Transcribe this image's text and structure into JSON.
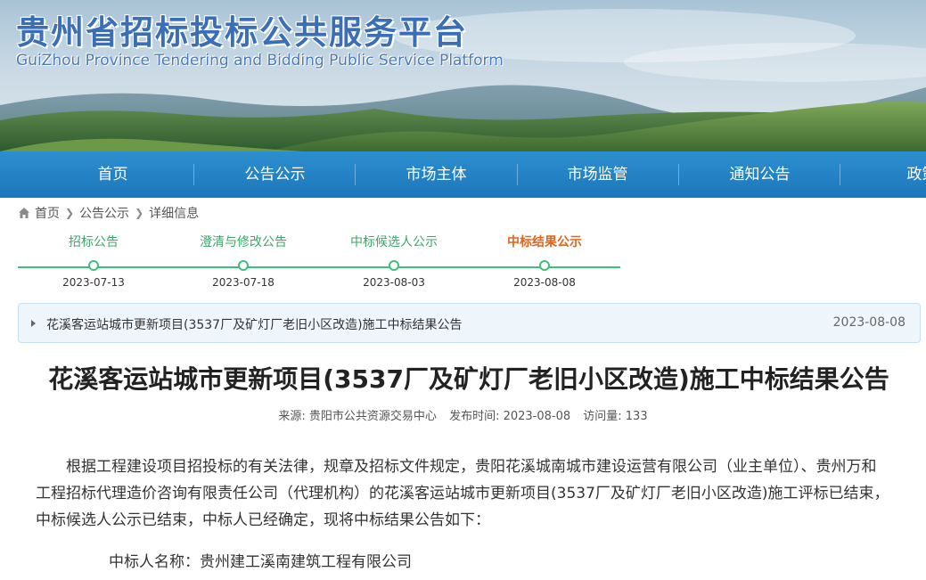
{
  "header": {
    "title": "贵州省招标投标公共服务平台",
    "subtitle": "GuiZhou Province Tendering and Bidding Public Service Platform"
  },
  "nav": {
    "items": [
      "首页",
      "公告公示",
      "市场主体",
      "市场监管",
      "通知公告",
      "政策"
    ]
  },
  "breadcrumb": {
    "items": [
      "首页",
      "公告公示",
      "详细信息"
    ]
  },
  "timeline": {
    "steps": [
      {
        "label": "招标公告",
        "date": "2023-07-13"
      },
      {
        "label": "澄清与修改公告",
        "date": "2023-07-18"
      },
      {
        "label": "中标候选人公示",
        "date": "2023-08-03"
      },
      {
        "label": "中标结果公示",
        "date": "2023-08-08"
      }
    ],
    "active_index": 3
  },
  "notice": {
    "title": "花溪客运站城市更新项目(3537厂及矿灯厂老旧小区改造)施工中标结果公告",
    "date": "2023-08-08"
  },
  "article": {
    "title": "花溪客运站城市更新项目(3537厂及矿灯厂老旧小区改造)施工中标结果公告",
    "meta": {
      "source": "来源: 贵阳市公共资源交易中心",
      "published": "发布时间: 2023-08-08",
      "views": "访问量: 133"
    },
    "paragraph": "根据工程建设项目招投标的有关法律，规章及招标文件规定，贵阳花溪城南城市建设运营有限公司（业主单位）、贵州万和工程招标代理造价咨询有限责任公司（代理机构）的花溪客运站城市更新项目(3537厂及矿灯厂老旧小区改造)施工评标已结束，中标候选人公示已结束，中标人已经确定，现将中标结果公告如下：",
    "winner": "中标人名称：贵州建工溪南建筑工程有限公司"
  },
  "colors": {
    "nav_bg": "#1f7cc0",
    "timeline_green": "#3fbf7a",
    "active_step": "#e4641a",
    "title_blue": "#3a6fb8"
  }
}
